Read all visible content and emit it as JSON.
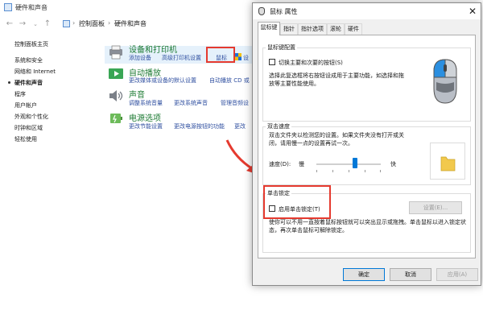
{
  "control_panel": {
    "title": "硬件和声音",
    "breadcrumb": [
      "控制面板",
      "硬件和声音"
    ],
    "sidebar": [
      {
        "label": "控制面板主页",
        "active": false
      },
      {
        "label": "系统和安全",
        "active": false
      },
      {
        "label": "网络和 Internet",
        "active": false
      },
      {
        "label": "硬件和声音",
        "active": true
      },
      {
        "label": "程序",
        "active": false
      },
      {
        "label": "用户帐户",
        "active": false
      },
      {
        "label": "外观和个性化",
        "active": false
      },
      {
        "label": "时钟和区域",
        "active": false
      },
      {
        "label": "轻松使用",
        "active": false
      }
    ],
    "categories": [
      {
        "title": "设备和打印机",
        "icon": "printer-icon",
        "links": [
          "添加设备",
          "高级打印机设置",
          "鼠标",
          "设"
        ]
      },
      {
        "title": "自动播放",
        "icon": "autoplay-icon",
        "links": [
          "更改媒体或设备的默认设置",
          "自动播放 CD 或"
        ]
      },
      {
        "title": "声音",
        "icon": "speaker-icon",
        "links": [
          "调整系统音量",
          "更改系统声音",
          "管理音频设"
        ]
      },
      {
        "title": "电源选项",
        "icon": "power-icon",
        "links": [
          "更改节能设置",
          "更改电源按钮的功能",
          "更改"
        ]
      }
    ]
  },
  "dialog": {
    "title": "鼠标 属性",
    "tabs": [
      "鼠标键",
      "指针",
      "指针选项",
      "滚轮",
      "硬件"
    ],
    "active_tab": "鼠标键",
    "button_config": {
      "group_label": "鼠标键配置",
      "checkbox_label": "切换主要和次要的按钮(S)",
      "checked": false,
      "description": "选择此复选框将右按钮设成用于主要功能，如选择和拖放等主要性能使用。"
    },
    "double_click": {
      "group_label": "双击速度",
      "description": "双击文件夹以检测您的设置。如果文件夹没有打开或关闭，请用慢一点的设置再试一次。",
      "speed_label": "速度(D):",
      "slow_label": "慢",
      "fast_label": "快",
      "speed_value": 0.6
    },
    "click_lock": {
      "group_label": "单击锁定",
      "checkbox_label": "启用单击锁定(T)",
      "checked": false,
      "settings_button": "设置(E)...",
      "description": "使你可以不用一直按着鼠标按钮就可以突出显示或拖拽。单击鼠标以进入锁定状态，再次单击鼠标可解除锁定。"
    },
    "buttons": {
      "ok": "确定",
      "cancel": "取消",
      "apply": "应用(A)"
    }
  },
  "colors": {
    "accent": "#0078d7",
    "annotation": "#e53a2f",
    "category_title": "#1e7b34",
    "link": "#2f4fa0"
  }
}
